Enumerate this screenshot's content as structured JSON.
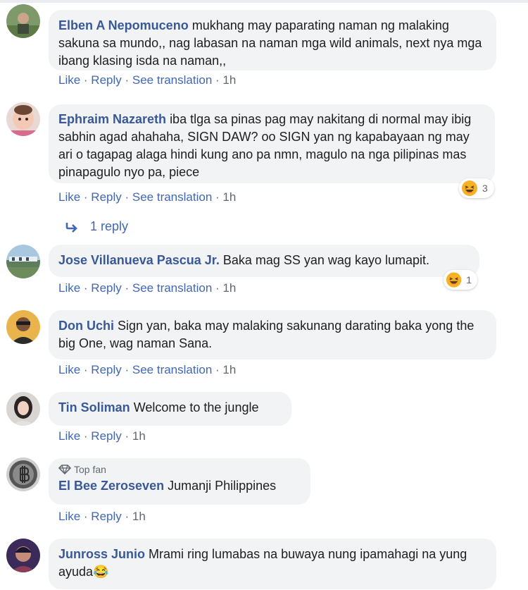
{
  "comments": [
    {
      "author": "Elben A Nepomuceno",
      "text": "mukhang may paparating naman ng malaking sakuna sa mundo,, nag labasan na naman mga wild animals, next nya mga ibang klasing isda na naman,,",
      "actions": {
        "like": "Like",
        "reply": "Reply",
        "translate": "See translation",
        "time": "1h"
      }
    },
    {
      "author": "Ephraim Nazareth",
      "text": "iba tlga sa pinas pag may nakitang di normal may ibig sabhin agad ahahaha, SIGN DAW? oo SIGN yan ng kapabayaan ng may ari o tagapag alaga hindi kung ano pa nmn, magulo na nga pilipinas mas pinapagulo nyo pa, piece",
      "actions": {
        "like": "Like",
        "reply": "Reply",
        "translate": "See translation",
        "time": "1h"
      },
      "reaction_count": "3",
      "replies_link": "1 reply"
    },
    {
      "author": "Jose Villanueva Pascua Jr.",
      "text": "Baka mag SS yan wag kayo lumapit.",
      "actions": {
        "like": "Like",
        "reply": "Reply",
        "translate": "See translation",
        "time": "1h"
      },
      "reaction_count": "1"
    },
    {
      "author": "Don Uchi",
      "text": "Sign yan, baka may malaking sakunang darating baka yong the big One, wag naman Sana.",
      "actions": {
        "like": "Like",
        "reply": "Reply",
        "translate": "See translation",
        "time": "1h"
      }
    },
    {
      "author": "Tin Soliman",
      "text": "Welcome to the jungle",
      "actions": {
        "like": "Like",
        "reply": "Reply",
        "time": "1h"
      }
    },
    {
      "badge": "Top fan",
      "author": "El Bee Zeroseven",
      "text": "Jumanji Philippines",
      "actions": {
        "like": "Like",
        "reply": "Reply",
        "time": "1h"
      }
    },
    {
      "author": "Junross Junio",
      "text": "Mrami ring lumabas na buwaya nung ipamahagi na yung ayuda😂"
    }
  ],
  "colors": {
    "name": "#385898",
    "link": "#4267b2",
    "bubble": "#f2f3f5",
    "meta": "#606770"
  }
}
